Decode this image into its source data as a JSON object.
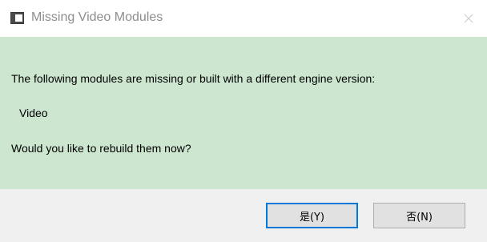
{
  "window": {
    "title": "Missing Video Modules",
    "app_icon": "window-icon",
    "close_icon": "close-icon"
  },
  "message": {
    "line1": "The following modules are missing or built with a different engine version:",
    "modules": [
      "Video"
    ],
    "line3": "Would you like to rebuild them now?"
  },
  "buttons": {
    "yes_label": "是(Y)",
    "no_label": "否(N)",
    "default": "yes"
  },
  "colors": {
    "content_background": "#cde6cf",
    "footer_background": "#f0f0f0",
    "default_button_border": "#0078d7"
  }
}
